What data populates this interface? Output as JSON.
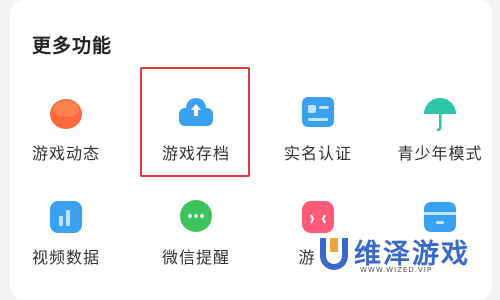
{
  "section": {
    "title": "更多功能"
  },
  "items": [
    {
      "label": "游戏动态",
      "icon": "game-news-icon"
    },
    {
      "label": "游戏存档",
      "icon": "cloud-save-icon"
    },
    {
      "label": "实名认证",
      "icon": "id-card-icon"
    },
    {
      "label": "青少年模式",
      "icon": "umbrella-icon"
    },
    {
      "label": "视频数据",
      "icon": "video-data-icon"
    },
    {
      "label": "微信提醒",
      "icon": "wechat-icon"
    },
    {
      "label": "游",
      "icon": "game-controller-icon"
    },
    {
      "label": "",
      "icon": "box-icon"
    }
  ],
  "watermark": {
    "text": "维泽游戏",
    "url": "WWW.WIZED.VIP"
  },
  "colors": {
    "highlight": "#e13b35",
    "orange": "#ff6a3d",
    "blue": "#3aa0f0",
    "teal": "#2ec6a8",
    "green": "#3ac45a",
    "pink": "#ff5a78"
  }
}
